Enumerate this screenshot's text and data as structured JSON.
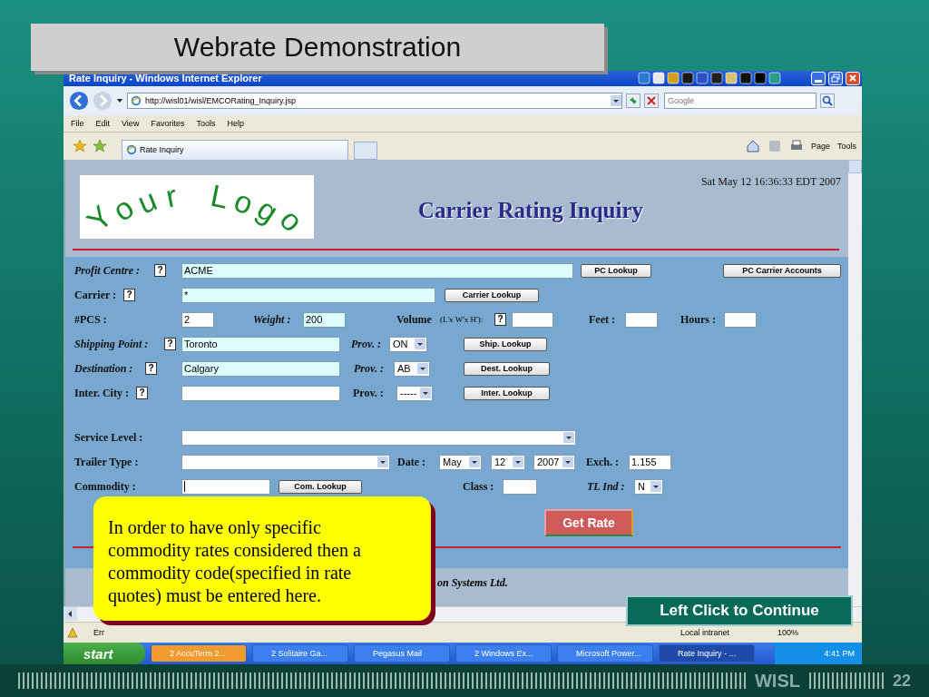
{
  "slide": {
    "title": "Webrate Demonstration",
    "footer_mark": "WISL",
    "page_number": "22"
  },
  "window": {
    "title": "Rate Inquiry - Windows Internet Explorer",
    "address": "http://wisl01/wisl/EMCORating_Inquiry.jsp",
    "search": {
      "placeholder": "Google"
    },
    "menu": [
      "File",
      "Edit",
      "View",
      "Favorites",
      "Tools",
      "Help"
    ],
    "tab": "Rate Inquiry",
    "commands": [
      "Page",
      "Tools"
    ]
  },
  "page": {
    "logo": "Your Logo",
    "timestamp": "Sat May 12 16:36:33 EDT 2007",
    "heading": "Carrier Rating Inquiry",
    "rows": [
      {
        "items": [
          {
            "kind": "label",
            "text": "Profit Centre :",
            "italic": true
          },
          {
            "kind": "help",
            "text": "?"
          },
          {
            "kind": "input",
            "value": "ACME",
            "required": true
          },
          {
            "kind": "button",
            "text": "PC Lookup"
          },
          {
            "kind": "button",
            "text": "PC Carrier Accounts"
          }
        ]
      },
      {
        "items": [
          {
            "kind": "label",
            "text": "Carrier :",
            "italic": false
          },
          {
            "kind": "help",
            "text": "?"
          },
          {
            "kind": "input",
            "value": "*",
            "required": true
          },
          {
            "kind": "button",
            "text": "Carrier Lookup"
          }
        ]
      },
      {
        "items": [
          {
            "kind": "label",
            "text": "#PCS :",
            "italic": false
          },
          {
            "kind": "input",
            "value": "2",
            "required": false
          },
          {
            "kind": "label",
            "text": "Weight :",
            "italic": true
          },
          {
            "kind": "input",
            "value": "200",
            "required": true
          },
          {
            "kind": "label",
            "text": "Volume",
            "italic": false
          },
          {
            "kind": "note",
            "text": "(L'x W'x H'):"
          },
          {
            "kind": "help",
            "text": "?"
          },
          {
            "kind": "input",
            "required": false
          },
          {
            "kind": "label",
            "text": "Feet :",
            "italic": false
          },
          {
            "kind": "input",
            "required": false
          },
          {
            "kind": "label",
            "text": "Hours :",
            "italic": false
          },
          {
            "kind": "input",
            "required": false
          }
        ]
      },
      {
        "items": [
          {
            "kind": "label",
            "text": "Shipping Point :",
            "italic": true
          },
          {
            "kind": "help",
            "text": "?"
          },
          {
            "kind": "input",
            "value": "Toronto",
            "required": true
          },
          {
            "kind": "label",
            "text": "Prov. :",
            "italic": true
          },
          {
            "kind": "select",
            "value": "ON"
          },
          {
            "kind": "button",
            "text": "Ship. Lookup"
          }
        ]
      },
      {
        "items": [
          {
            "kind": "label",
            "text": "Destination :",
            "italic": true
          },
          {
            "kind": "help",
            "text": "?"
          },
          {
            "kind": "input",
            "value": "Calgary",
            "required": true
          },
          {
            "kind": "label",
            "text": "Prov. :",
            "italic": true
          },
          {
            "kind": "select",
            "value": "AB"
          },
          {
            "kind": "button",
            "text": "Dest. Lookup"
          }
        ]
      },
      {
        "items": [
          {
            "kind": "label",
            "text": "Inter. City :",
            "italic": false
          },
          {
            "kind": "help",
            "text": "?"
          },
          {
            "kind": "input",
            "required": false
          },
          {
            "kind": "label",
            "text": "Prov. :",
            "italic": false
          },
          {
            "kind": "select",
            "value": "-----"
          },
          {
            "kind": "button",
            "text": "Inter. Lookup"
          }
        ]
      },
      {
        "items": [
          {
            "kind": "label",
            "text": "Service Level :",
            "italic": false
          },
          {
            "kind": "select"
          }
        ]
      },
      {
        "items": [
          {
            "kind": "label",
            "text": "Trailer Type :",
            "italic": false
          },
          {
            "kind": "select"
          },
          {
            "kind": "label",
            "text": "Date :",
            "italic": false
          },
          {
            "kind": "select",
            "value": "May"
          },
          {
            "kind": "select",
            "value": "12"
          },
          {
            "kind": "select",
            "value": "2007"
          },
          {
            "kind": "label",
            "text": "Exch. :",
            "italic": false
          },
          {
            "kind": "input",
            "value": "1.155",
            "required": false
          }
        ]
      },
      {
        "items": [
          {
            "kind": "label",
            "text": "Commodity :",
            "italic": false
          },
          {
            "kind": "input",
            "required": false,
            "focused": true
          },
          {
            "kind": "button",
            "text": "Com. Lookup"
          },
          {
            "kind": "label",
            "text": "Class :",
            "italic": false
          },
          {
            "kind": "input",
            "required": false
          },
          {
            "kind": "label",
            "text": "TL Ind :",
            "italic": true
          },
          {
            "kind": "select",
            "value": "N"
          }
        ]
      }
    ],
    "action": "Get Rate",
    "footer": "on Systems Ltd."
  },
  "status_bar": {
    "message": "Err",
    "zone": "Local intranet",
    "zoom": "100%"
  },
  "taskbar": {
    "start": "start",
    "items": [
      {
        "label": "2 AccuTerm 2...",
        "selected": false,
        "flashing": true
      },
      {
        "label": "2 Solitaire Ga...",
        "selected": false,
        "flashing": false
      },
      {
        "label": "Pegasus Mail",
        "selected": false,
        "flashing": false
      },
      {
        "label": "2 Windows Ex...",
        "selected": false,
        "flashing": false
      },
      {
        "label": "Microsoft Power...",
        "selected": false,
        "flashing": false
      },
      {
        "label": "Rate Inquiry - ...",
        "selected": true,
        "flashing": false
      }
    ],
    "clock": "4:41 PM"
  },
  "callout": {
    "text": "In order to have only specific commodity rates considered then a commodity code(specified in rate quotes) must be entered here."
  },
  "continue_button": "Left Click to Continue"
}
